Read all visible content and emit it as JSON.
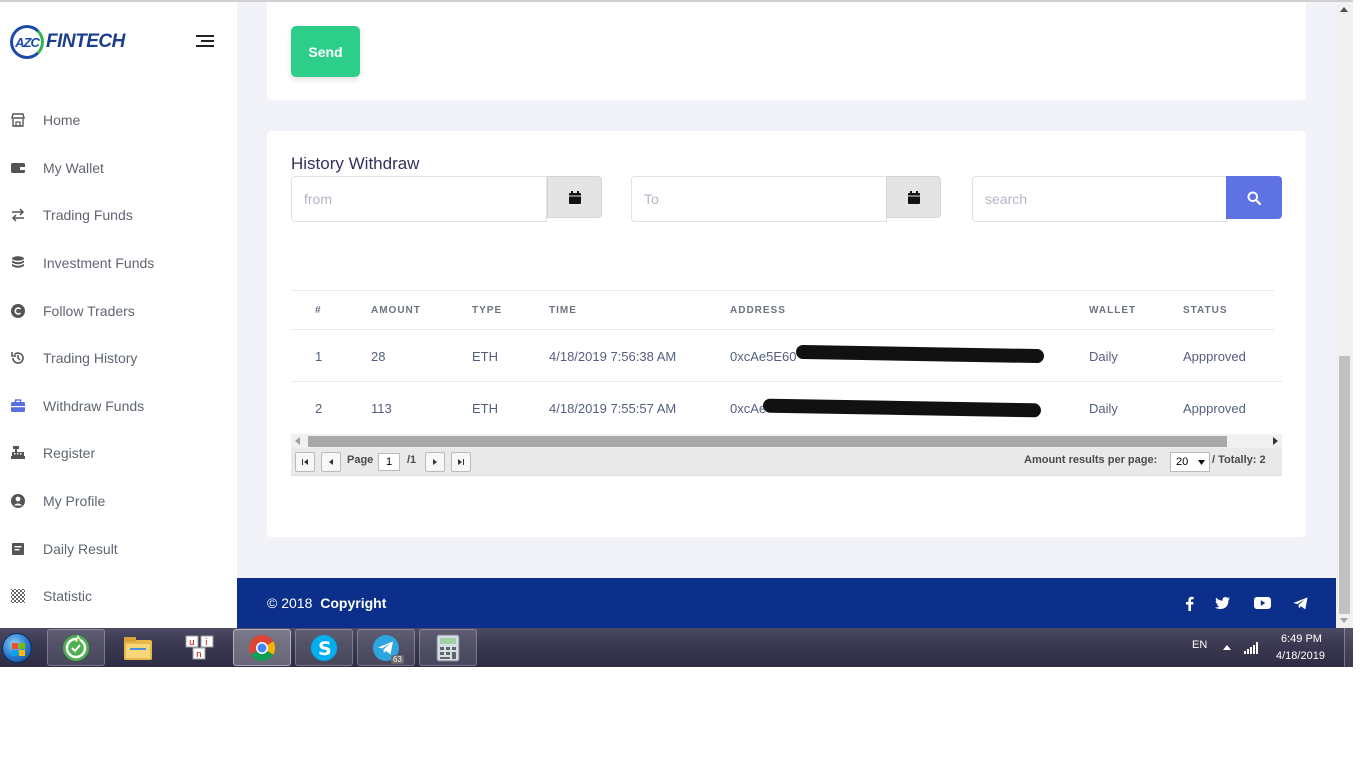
{
  "brand": {
    "logo_mark": "AZC",
    "logo_text": "FINTECH"
  },
  "sidebar": {
    "items": [
      {
        "label": "Home",
        "icon": "storefront-icon"
      },
      {
        "label": "My Wallet",
        "icon": "wallet-icon"
      },
      {
        "label": "Trading Funds",
        "icon": "exchange-arrows-icon"
      },
      {
        "label": "Investment Funds",
        "icon": "database-icon"
      },
      {
        "label": "Follow Traders",
        "icon": "copyright-circle-icon"
      },
      {
        "label": "Trading History",
        "icon": "history-icon"
      },
      {
        "label": "Withdraw Funds",
        "icon": "briefcase-icon",
        "active": true
      },
      {
        "label": "Register",
        "icon": "cash-register-icon"
      },
      {
        "label": "My Profile",
        "icon": "user-circle-icon"
      },
      {
        "label": "Daily Result",
        "icon": "document-icon"
      },
      {
        "label": "Statistic",
        "icon": "checker-icon"
      }
    ]
  },
  "form": {
    "send_label": "Send"
  },
  "history": {
    "title": "History Withdraw",
    "from_placeholder": "from",
    "to_placeholder": "To",
    "search_placeholder": "search",
    "columns": [
      "#",
      "AMOUNT",
      "TYPE",
      "TIME",
      "ADDRESS",
      "WALLET",
      "STATUS"
    ],
    "rows": [
      {
        "num": "1",
        "amount": "28",
        "type": "ETH",
        "time": "4/18/2019 7:56:38 AM",
        "address": "0xcAe5E60",
        "wallet": "Daily",
        "status": "Appproved"
      },
      {
        "num": "2",
        "amount": "113",
        "type": "ETH",
        "time": "4/18/2019 7:55:57 AM",
        "address": "0xcAe",
        "wallet": "Daily",
        "status": "Appproved"
      }
    ],
    "pager": {
      "page_label": "Page",
      "page_value": "1",
      "page_total": "/1",
      "per_page_label": "Amount results per page:",
      "per_page_value": "20",
      "total_label": "/ Totally: 2"
    }
  },
  "footer": {
    "copy_prefix": "© 2018",
    "copy_text": "Copyright",
    "social": [
      "facebook-icon",
      "twitter-icon",
      "youtube-icon",
      "telegram-icon"
    ]
  },
  "taskbar": {
    "apps": [
      "coccoc-browser",
      "file-explorer",
      "unikey",
      "chrome",
      "skype",
      "telegram",
      "calculator"
    ],
    "telegram_badge": "63",
    "language": "EN",
    "time": "6:49 PM",
    "date": "4/18/2019"
  },
  "colors": {
    "accent": "#5e72e4",
    "send": "#2dce89",
    "footer": "#0b2f8a",
    "text": "#525f7f"
  }
}
